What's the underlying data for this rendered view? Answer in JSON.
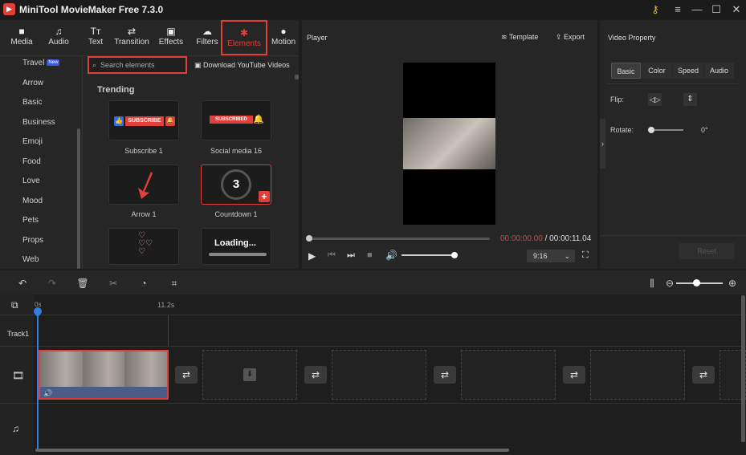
{
  "app": {
    "title": "MiniTool MovieMaker Free 7.3.0"
  },
  "toolbar": [
    {
      "label": "Media",
      "icon": "folder-icon"
    },
    {
      "label": "Audio",
      "icon": "music-note-icon"
    },
    {
      "label": "Text",
      "icon": "text-icon"
    },
    {
      "label": "Transition",
      "icon": "transition-icon"
    },
    {
      "label": "Effects",
      "icon": "effects-icon"
    },
    {
      "label": "Filters",
      "icon": "filters-icon"
    },
    {
      "label": "Elements",
      "icon": "elements-icon"
    },
    {
      "label": "Motion",
      "icon": "motion-icon"
    }
  ],
  "categories": [
    "Travel",
    "Arrow",
    "Basic",
    "Business",
    "Emoji",
    "Food",
    "Love",
    "Mood",
    "Pets",
    "Props",
    "Web"
  ],
  "new_badge": "New",
  "search": {
    "placeholder": "Search elements"
  },
  "youtube_link": "Download YouTube Videos",
  "trending_title": "Trending",
  "cards": [
    {
      "label": "Subscribe 1",
      "text": "SUBSCRIBE"
    },
    {
      "label": "Social media 16",
      "text": "SUBSCRIBED"
    },
    {
      "label": "Arrow 1",
      "text": ""
    },
    {
      "label": "Countdown 1",
      "text": "3"
    },
    {
      "label": "",
      "text": ""
    },
    {
      "label": "",
      "text": "Loading..."
    }
  ],
  "player": {
    "title": "Player",
    "template_label": "Template",
    "export_label": "Export",
    "time_current": "00:00:00.00",
    "time_separator": "/",
    "time_total": "00:00:11.04",
    "aspect": "9:16",
    "progress": 0,
    "volume": 1.0
  },
  "properties": {
    "title": "Video Property",
    "tabs": [
      "Basic",
      "Color",
      "Speed",
      "Audio"
    ],
    "flip_label": "Flip:",
    "rotate_label": "Rotate:",
    "rotate_value": "0°",
    "reset_label": "Reset"
  },
  "timeline": {
    "ruler_start": "0s",
    "ruler_mark": "11.2s",
    "track1_label": "Track1"
  },
  "colors": {
    "accent": "#e0403a",
    "playhead": "#2f7fe0"
  }
}
